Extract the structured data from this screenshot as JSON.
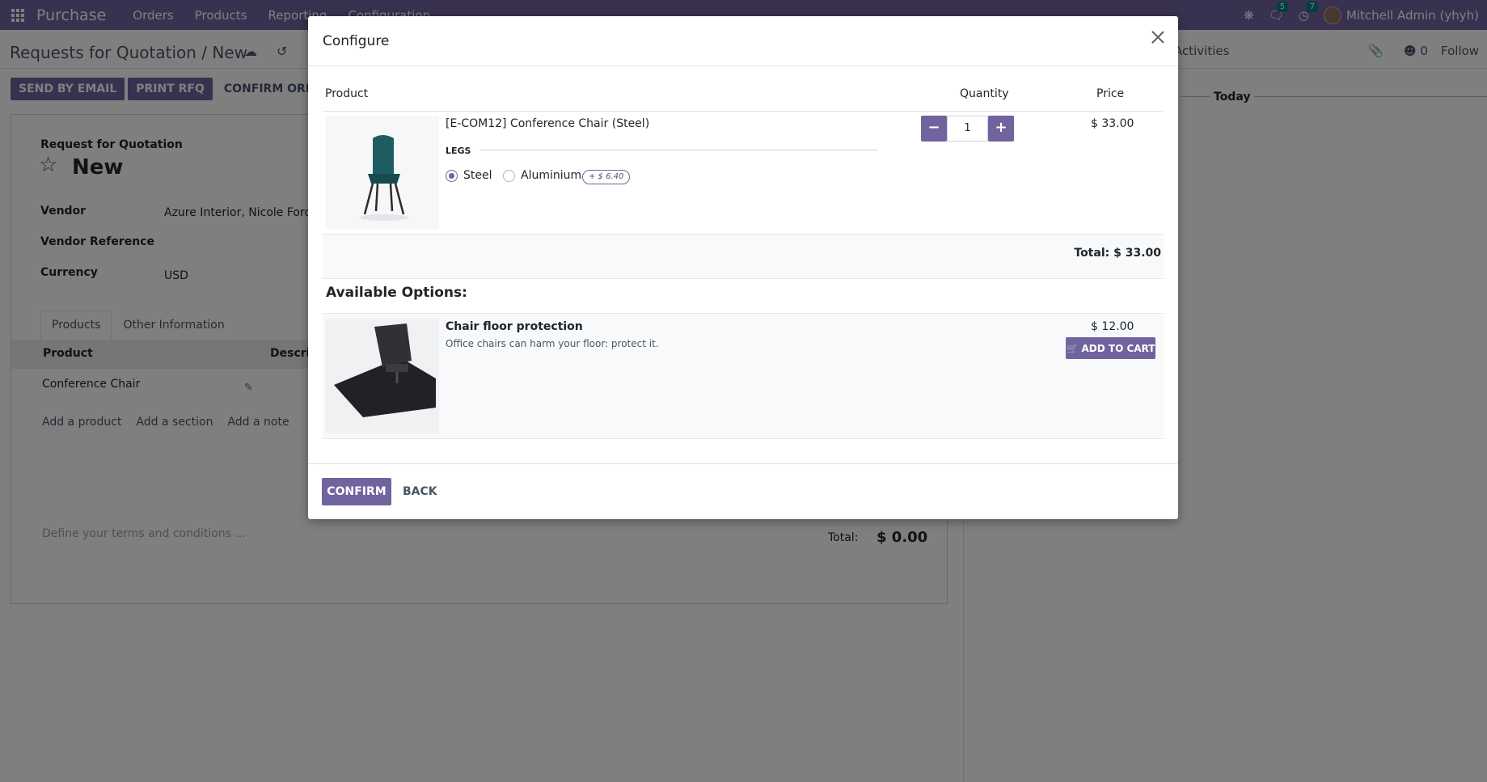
{
  "navbar": {
    "brand": "Purchase",
    "menus": [
      "Orders",
      "Products",
      "Reporting",
      "Configuration"
    ],
    "messages_count": "5",
    "activities_count": "7",
    "user": "Mitchell Admin (yhyh)"
  },
  "control_panel": {
    "breadcrumb": "Requests for Quotation / New",
    "activities_label": "Activities",
    "followers_count": "0",
    "follow_label": "Follow"
  },
  "form_buttons": {
    "send_email": "SEND BY EMAIL",
    "print_rfq": "PRINT RFQ",
    "confirm_order": "CONFIRM ORDER"
  },
  "form": {
    "subtitle": "Request for Quotation",
    "title": "New",
    "vendor_label": "Vendor",
    "vendor_value": "Azure Interior, Nicole Ford",
    "vendor_ref_label": "Vendor Reference",
    "currency_label": "Currency",
    "currency_value": "USD",
    "tabs": [
      "Products",
      "Other Information"
    ],
    "col_product": "Product",
    "col_description": "Descrip",
    "row_product": "Conference Chair",
    "add_product": "Add a product",
    "add_section": "Add a section",
    "add_note": "Add a note",
    "terms_placeholder": "Define your terms and conditions ...",
    "total_label": "Total:",
    "total_value": "$ 0.00"
  },
  "chatter": {
    "today": "Today"
  },
  "modal": {
    "title": "Configure",
    "header_product": "Product",
    "header_quantity": "Quantity",
    "header_price": "Price",
    "product_name": "[E-COM12] Conference Chair (Steel)",
    "attribute_label": "LEGS",
    "options": [
      {
        "label": "Steel",
        "selected": true
      },
      {
        "label": "Aluminium",
        "selected": false,
        "extra": "+ $ 6.40"
      }
    ],
    "quantity": "1",
    "price": "$ 33.00",
    "total": "Total: $ 33.00",
    "available_options_title": "Available Options:",
    "optional_product": {
      "name": "Chair floor protection",
      "description": "Office chairs can harm your floor: protect it.",
      "price": "$ 12.00",
      "add_to_cart": "ADD TO CART"
    },
    "confirm": "CONFIRM",
    "back": "BACK"
  },
  "colors": {
    "brand": "#71639e",
    "badge": "#017e84"
  }
}
